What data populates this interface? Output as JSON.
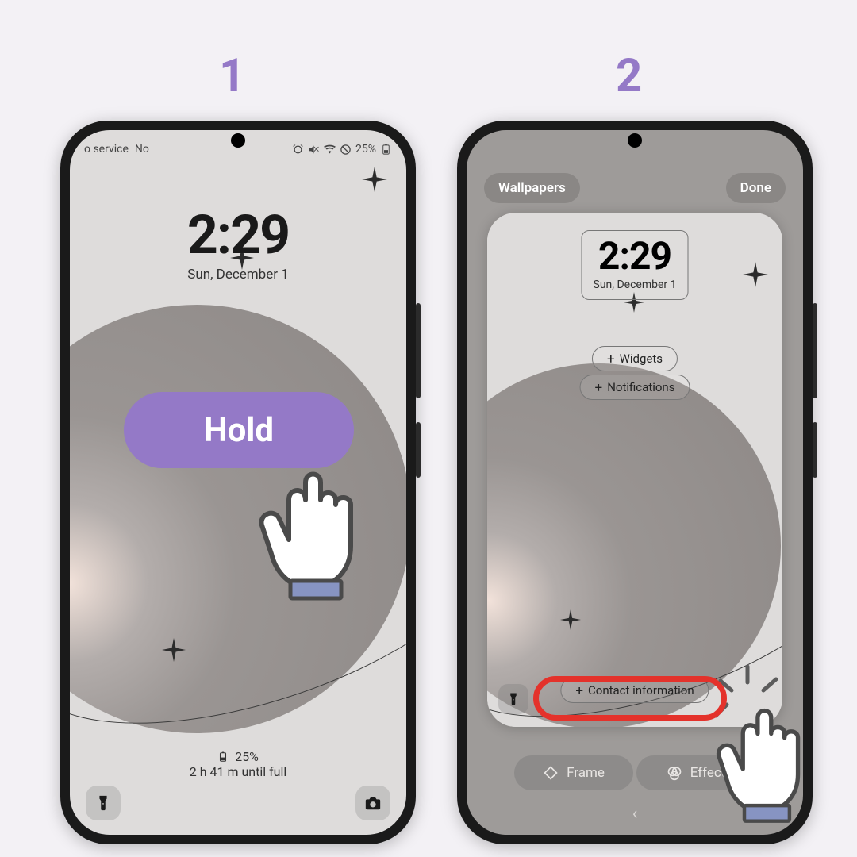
{
  "steps": {
    "one": "1",
    "two": "2"
  },
  "screen1": {
    "status": {
      "left_service": "o service",
      "left_no": "No",
      "battery_text": "25%"
    },
    "clock": {
      "time": "2:29",
      "date": "Sun, December 1"
    },
    "battery": {
      "percent": "25%",
      "until_full": "2 h 41 m until full"
    },
    "overlay": {
      "hold": "Hold"
    },
    "icons": {
      "sparkle_top": "sparkle-icon",
      "flashlight": "flashlight-icon",
      "camera": "camera-icon",
      "alarm": "alarm-icon",
      "mute": "mute-icon",
      "wifi": "wifi-icon",
      "dnd": "do-not-disturb-icon",
      "battery": "battery-icon"
    }
  },
  "screen2": {
    "top": {
      "wallpapers": "Wallpapers",
      "done": "Done"
    },
    "clock": {
      "time": "2:29",
      "date": "Sun, December 1"
    },
    "add": {
      "widgets": "Widgets",
      "notifications": "Notifications",
      "contact": "Contact information"
    },
    "bottom": {
      "frame": "Frame",
      "effect": "Effect"
    },
    "icons": {
      "flashlight": "flashlight-icon",
      "frame": "frame-shape-icon",
      "effect": "color-filter-icon",
      "back": "chevron-left-icon"
    }
  },
  "accent": "#9479c7"
}
